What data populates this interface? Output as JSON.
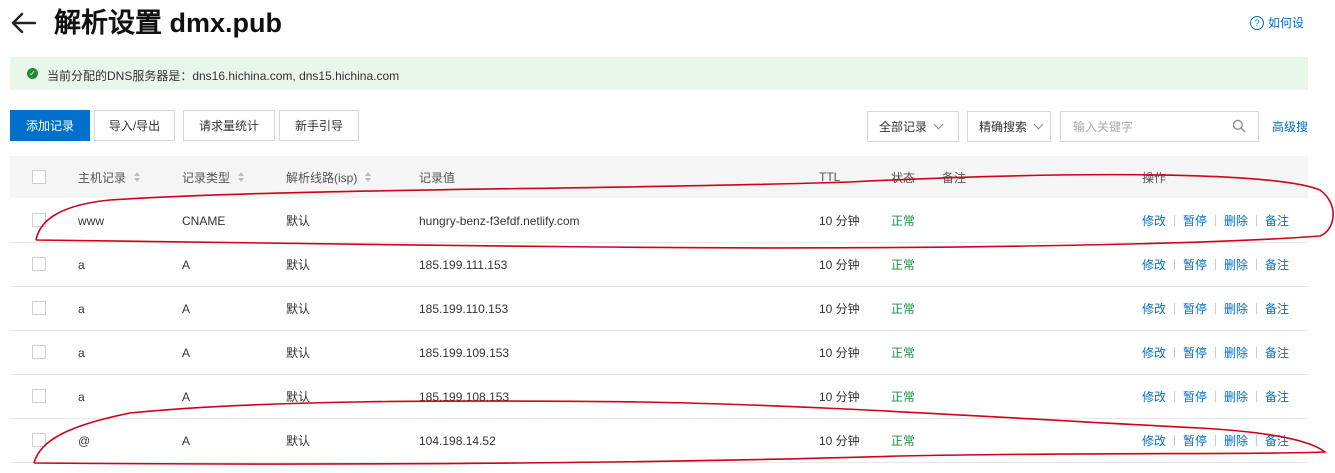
{
  "header": {
    "title": "解析设置 dmx.pub",
    "help": "如何设"
  },
  "banner": {
    "text": "当前分配的DNS服务器是：dns16.hichina.com, dns15.hichina.com"
  },
  "toolbar": {
    "add": "添加记录",
    "import_export": "导入/导出",
    "stats": "请求量统计",
    "guide": "新手引导",
    "filter_all": "全部记录",
    "precise_search": "精确搜索",
    "search_placeholder": "输入关键字",
    "advanced": "高级搜"
  },
  "table": {
    "columns": {
      "host": "主机记录",
      "type": "记录类型",
      "line": "解析线路(isp)",
      "value": "记录值",
      "ttl": "TTL",
      "status": "状态",
      "remark": "备注",
      "ops": "操作"
    },
    "actions": [
      "修改",
      "暂停",
      "删除",
      "备注"
    ],
    "rows": [
      {
        "host": "www",
        "type": "CNAME",
        "line": "默认",
        "value": "hungry-benz-f3efdf.netlify.com",
        "ttl": "10 分钟",
        "status": "正常"
      },
      {
        "host": "a",
        "type": "A",
        "line": "默认",
        "value": "185.199.111.153",
        "ttl": "10 分钟",
        "status": "正常"
      },
      {
        "host": "a",
        "type": "A",
        "line": "默认",
        "value": "185.199.110.153",
        "ttl": "10 分钟",
        "status": "正常"
      },
      {
        "host": "a",
        "type": "A",
        "line": "默认",
        "value": "185.199.109.153",
        "ttl": "10 分钟",
        "status": "正常"
      },
      {
        "host": "a",
        "type": "A",
        "line": "默认",
        "value": "185.199.108.153",
        "ttl": "10 分钟",
        "status": "正常"
      },
      {
        "host": "@",
        "type": "A",
        "line": "默认",
        "value": "104.198.14.52",
        "ttl": "10 分钟",
        "status": "正常"
      }
    ]
  },
  "colors": {
    "primary": "#0070cc",
    "success": "#1e8e3e",
    "banner_bg": "#e9f7ea",
    "annotation": "#d0021b"
  }
}
